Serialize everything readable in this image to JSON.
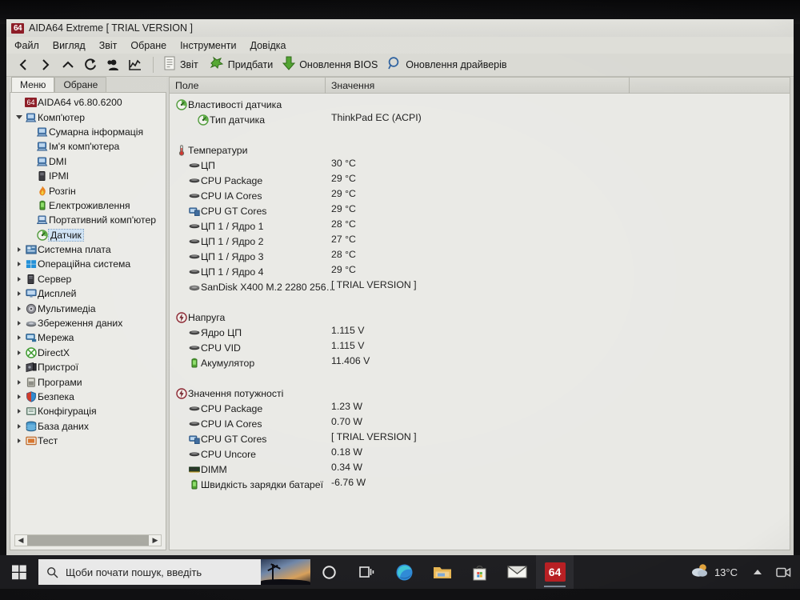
{
  "window": {
    "title": "AIDA64 Extreme  [ TRIAL VERSION ]",
    "badge": "64",
    "menu": [
      "Файл",
      "Вигляд",
      "Звіт",
      "Обране",
      "Інструменти",
      "Довідка"
    ],
    "toolbar_icons": [
      "back-arrow-icon",
      "forward-arrow-icon",
      "up-arrow-icon",
      "refresh-icon",
      "user-icon",
      "chart-icon"
    ],
    "toolbar_items": [
      {
        "icon": "report-page-icon",
        "label": "Звіт"
      },
      {
        "icon": "star-burst-icon",
        "label": "Придбати"
      },
      {
        "icon": "green-down-arrow-icon",
        "label": "Оновлення BIOS"
      },
      {
        "icon": "magnifier-icon",
        "label": "Оновлення драйверів"
      }
    ]
  },
  "tree": {
    "tabs": [
      {
        "label": "Меню",
        "active": true
      },
      {
        "label": "Обране",
        "active": false
      }
    ],
    "root": {
      "badge": "64",
      "label": "AIDA64 v6.80.6200"
    },
    "items": [
      {
        "label": "Комп'ютер",
        "level": 0,
        "twisty": "down",
        "icon": "computer-icon",
        "selected": false
      },
      {
        "label": "Сумарна інформація",
        "level": 1,
        "twisty": "none",
        "icon": "computer-icon",
        "selected": false
      },
      {
        "label": "Ім'я комп'ютера",
        "level": 1,
        "twisty": "none",
        "icon": "computer-icon",
        "selected": false
      },
      {
        "label": "DMI",
        "level": 1,
        "twisty": "none",
        "icon": "computer-icon",
        "selected": false
      },
      {
        "label": "IPMI",
        "level": 1,
        "twisty": "none",
        "icon": "server-icon",
        "selected": false
      },
      {
        "label": "Розгін",
        "level": 1,
        "twisty": "none",
        "icon": "flame-icon",
        "selected": false
      },
      {
        "label": "Електроживлення",
        "level": 1,
        "twisty": "none",
        "icon": "battery-icon",
        "selected": false
      },
      {
        "label": "Портативний комп'ютер",
        "level": 1,
        "twisty": "none",
        "icon": "laptop-icon",
        "selected": false
      },
      {
        "label": "Датчик",
        "level": 1,
        "twisty": "none",
        "icon": "sensor-gauge-icon",
        "selected": true
      },
      {
        "label": "Системна плата",
        "level": 0,
        "twisty": "right",
        "icon": "motherboard-icon",
        "selected": false
      },
      {
        "label": "Операційна система",
        "level": 0,
        "twisty": "right",
        "icon": "windows-icon",
        "selected": false
      },
      {
        "label": "Сервер",
        "level": 0,
        "twisty": "right",
        "icon": "server-icon",
        "selected": false
      },
      {
        "label": "Дисплей",
        "level": 0,
        "twisty": "right",
        "icon": "display-icon",
        "selected": false
      },
      {
        "label": "Мультимедіа",
        "level": 0,
        "twisty": "right",
        "icon": "speaker-icon",
        "selected": false
      },
      {
        "label": "Збереження даних",
        "level": 0,
        "twisty": "right",
        "icon": "disk-icon",
        "selected": false
      },
      {
        "label": "Мережа",
        "level": 0,
        "twisty": "right",
        "icon": "network-icon",
        "selected": false
      },
      {
        "label": "DirectX",
        "level": 0,
        "twisty": "right",
        "icon": "directx-icon",
        "selected": false
      },
      {
        "label": "Пристрої",
        "level": 0,
        "twisty": "right",
        "icon": "devices-icon",
        "selected": false
      },
      {
        "label": "Програми",
        "level": 0,
        "twisty": "right",
        "icon": "programs-icon",
        "selected": false
      },
      {
        "label": "Безпека",
        "level": 0,
        "twisty": "right",
        "icon": "shield-icon",
        "selected": false
      },
      {
        "label": "Конфігурація",
        "level": 0,
        "twisty": "right",
        "icon": "config-icon",
        "selected": false
      },
      {
        "label": "База даних",
        "level": 0,
        "twisty": "right",
        "icon": "database-icon",
        "selected": false
      },
      {
        "label": "Тест",
        "level": 0,
        "twisty": "right",
        "icon": "benchmark-icon",
        "selected": false
      }
    ]
  },
  "list": {
    "columns": [
      "Поле",
      "Значення"
    ],
    "rows": [
      {
        "kind": "group",
        "icon": "sensor-gauge-icon",
        "field": "Властивості датчика",
        "value": ""
      },
      {
        "kind": "item2",
        "icon": "sensor-gauge-icon",
        "field": "Тип датчика",
        "value": "ThinkPad EC  (ACPI)"
      },
      {
        "kind": "spacer"
      },
      {
        "kind": "group",
        "icon": "thermometer-icon",
        "field": "Температури",
        "value": ""
      },
      {
        "kind": "item",
        "icon": "cpu-chip-icon",
        "field": "ЦП",
        "value": "30 °C"
      },
      {
        "kind": "item",
        "icon": "cpu-chip-icon",
        "field": "CPU Package",
        "value": "29 °C"
      },
      {
        "kind": "item",
        "icon": "cpu-chip-icon",
        "field": "CPU IA Cores",
        "value": "29 °C"
      },
      {
        "kind": "item",
        "icon": "gpu-icon",
        "field": "CPU GT Cores",
        "value": "29 °C"
      },
      {
        "kind": "item",
        "icon": "cpu-chip-icon",
        "field": "ЦП 1 / Ядро 1",
        "value": "28 °C"
      },
      {
        "kind": "item",
        "icon": "cpu-chip-icon",
        "field": "ЦП 1 / Ядро 2",
        "value": "27 °C"
      },
      {
        "kind": "item",
        "icon": "cpu-chip-icon",
        "field": "ЦП 1 / Ядро 3",
        "value": "28 °C"
      },
      {
        "kind": "item",
        "icon": "cpu-chip-icon",
        "field": "ЦП 1 / Ядро 4",
        "value": "29 °C"
      },
      {
        "kind": "item",
        "icon": "hdd-icon",
        "field": "SanDisk X400 M.2 2280 256…",
        "value": "[ TRIAL VERSION ]"
      },
      {
        "kind": "spacer"
      },
      {
        "kind": "group",
        "icon": "voltage-bolt-icon",
        "field": "Напруга",
        "value": ""
      },
      {
        "kind": "item",
        "icon": "cpu-chip-icon",
        "field": "Ядро ЦП",
        "value": "1.115 V"
      },
      {
        "kind": "item",
        "icon": "cpu-chip-icon",
        "field": "CPU VID",
        "value": "1.115 V"
      },
      {
        "kind": "item",
        "icon": "battery-icon",
        "field": "Акумулятор",
        "value": "11.406 V"
      },
      {
        "kind": "spacer"
      },
      {
        "kind": "group",
        "icon": "voltage-bolt-icon",
        "field": "Значення потужності",
        "value": ""
      },
      {
        "kind": "item",
        "icon": "cpu-chip-icon",
        "field": "CPU Package",
        "value": "1.23 W"
      },
      {
        "kind": "item",
        "icon": "cpu-chip-icon",
        "field": "CPU IA Cores",
        "value": "0.70 W"
      },
      {
        "kind": "item",
        "icon": "gpu-icon",
        "field": "CPU GT Cores",
        "value": "[ TRIAL VERSION ]"
      },
      {
        "kind": "item",
        "icon": "cpu-chip-icon",
        "field": "CPU Uncore",
        "value": "0.18 W"
      },
      {
        "kind": "item",
        "icon": "dimm-icon",
        "field": "DIMM",
        "value": "0.34 W"
      },
      {
        "kind": "item",
        "icon": "battery-icon",
        "field": "Швидкість зарядки батареї",
        "value": "-6.76 W"
      }
    ]
  },
  "taskbar": {
    "start_icon": "windows-start-icon",
    "search_placeholder": "Щоби почати пошук, введіть",
    "search_icon": "search-icon",
    "tasks": [
      {
        "icon": "cortana-circle-icon",
        "active": false
      },
      {
        "icon": "task-view-icon",
        "active": false
      },
      {
        "icon": "edge-browser-icon",
        "active": false
      },
      {
        "icon": "file-explorer-icon",
        "active": false
      },
      {
        "icon": "microsoft-store-icon",
        "active": false
      },
      {
        "icon": "mail-icon",
        "active": false
      },
      {
        "icon": "aida64-icon",
        "active": true,
        "label": "64"
      }
    ],
    "tray": {
      "weather_icon": "partly-cloudy-icon",
      "temperature": "13°C",
      "overflow_icon": "show-hidden-icons-chevron",
      "extra_icon": "meet-now-icon"
    }
  },
  "colors": {
    "accent_red": "#8d1d27",
    "green": "#3f8f2a",
    "window_bg": "#d3d3ce",
    "list_bg": "#e9e9e5",
    "taskbar_bg": "#1d1d20"
  }
}
